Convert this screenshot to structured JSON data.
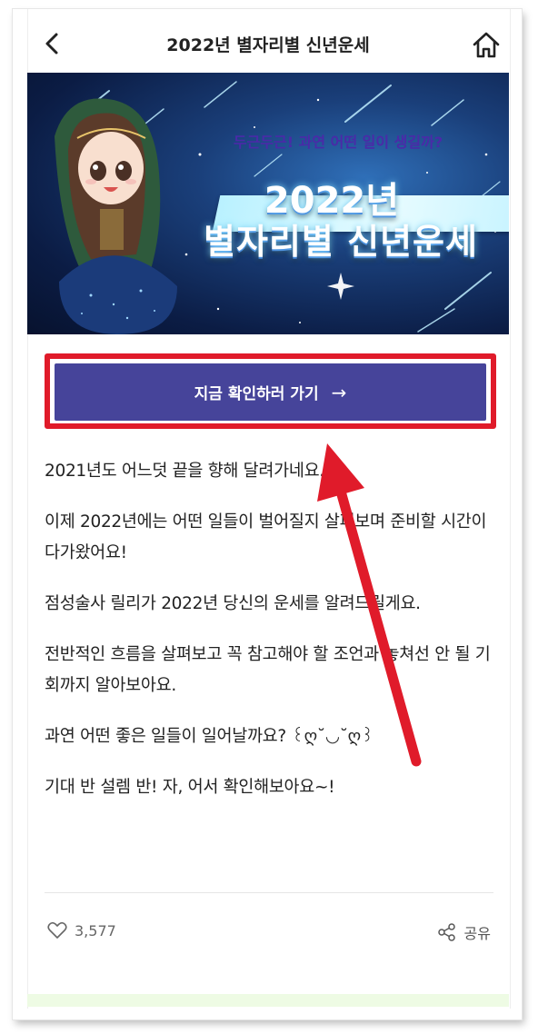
{
  "header": {
    "title": "2022년 별자리별 신년운세",
    "back_icon": "chevron-left-icon",
    "home_icon": "home-icon"
  },
  "banner": {
    "subtitle": "두근두근! 과연 어떤 일이 생길까?",
    "year": "2022년",
    "main_title": "별자리별 신년운세"
  },
  "cta": {
    "label": "지금 확인하러 가기",
    "arrow": "→",
    "button_color": "#46449a",
    "highlight_color": "#e01b2a"
  },
  "paragraphs": [
    "2021년도 어느덧 끝을 향해 달려가네요.",
    "이제 2022년에는 어떤 일들이 벌어질지 살펴보며 준비할 시간이 다가왔어요!",
    "점성술사 릴리가 2022년 당신의 운세를 알려드릴게요.",
    "전반적인 흐름을 살펴보고 꼭 참고해야 할 조언과 놓쳐선 안 될 기회까지 알아보아요.",
    "과연 어떤 좋은 일들이 일어날까요? ꒰ღ˘◡˘ღ꒱",
    "기대 반 설렘 반! 자, 어서 확인해보아요~!"
  ],
  "footer": {
    "like_icon": "heart-icon",
    "like_count": "3,577",
    "share_icon": "share-icon",
    "share_label": "공유"
  }
}
